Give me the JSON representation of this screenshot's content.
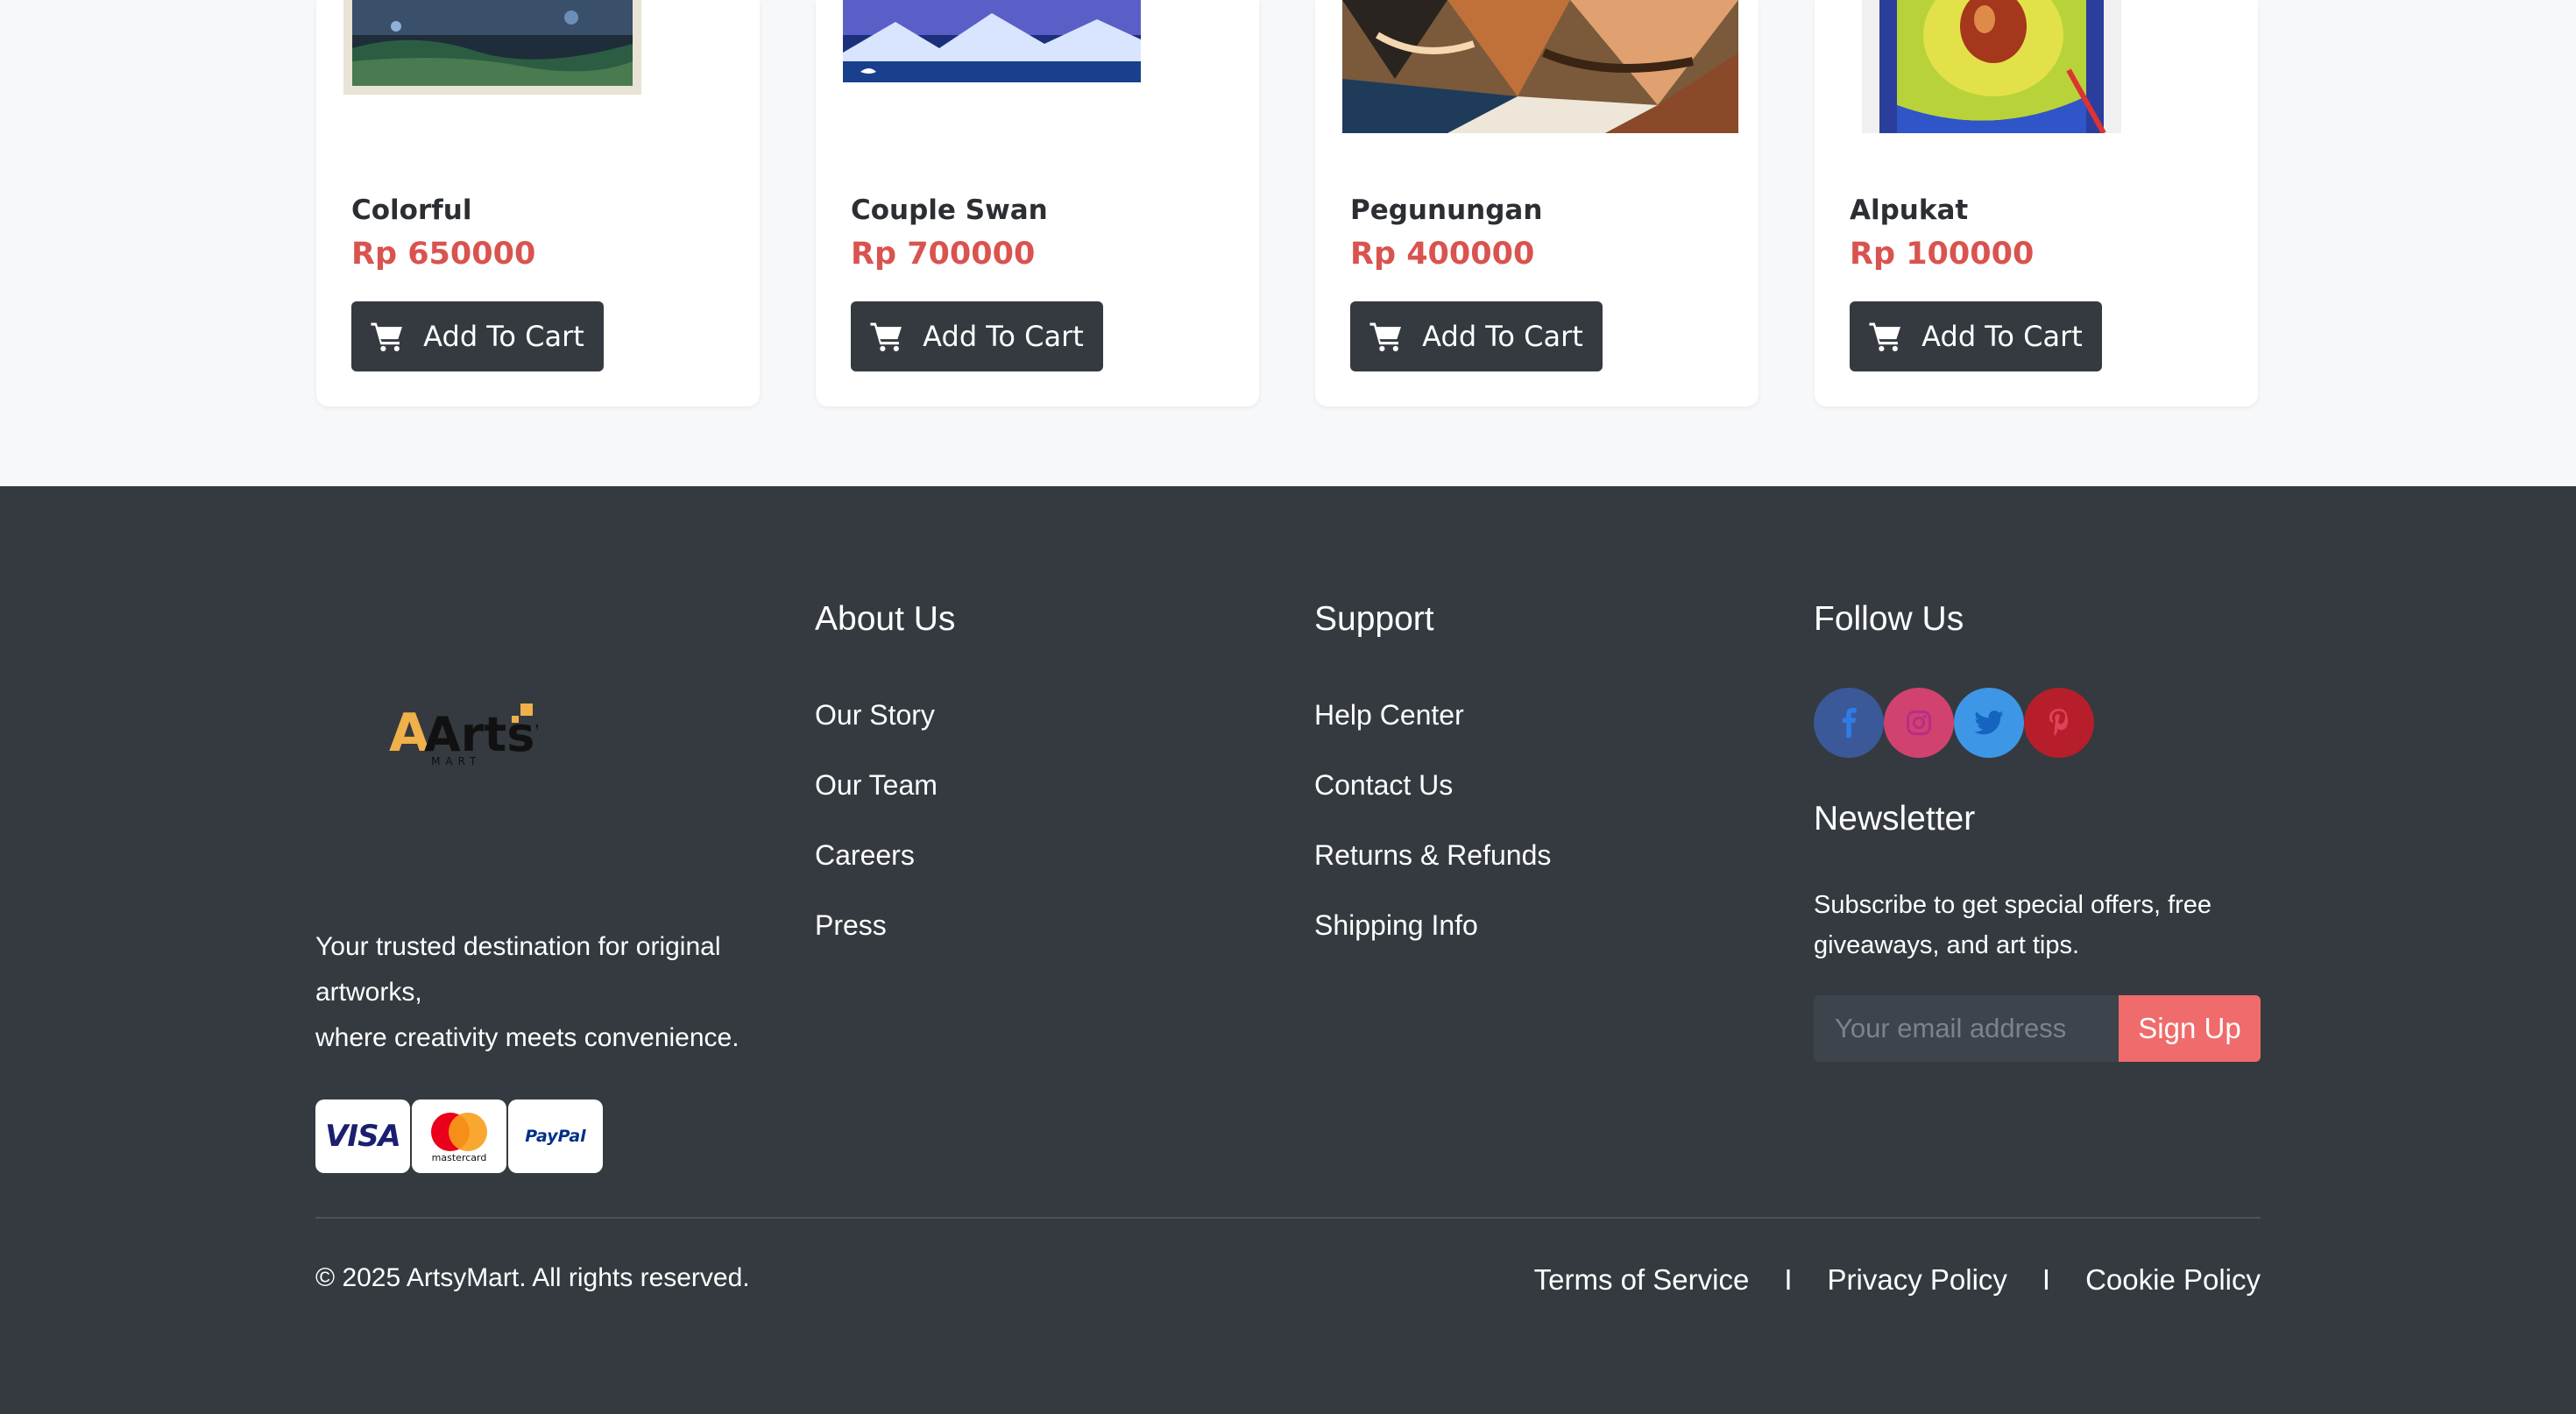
{
  "products": [
    {
      "name": "Colorful",
      "price": "Rp 650000",
      "button": "Add To Cart"
    },
    {
      "name": "Couple Swan",
      "price": "Rp 700000",
      "button": "Add To Cart"
    },
    {
      "name": "Pegunungan",
      "price": "Rp 400000",
      "button": "Add To Cart"
    },
    {
      "name": "Alpukat",
      "price": "Rp 100000",
      "button": "Add To Cart"
    }
  ],
  "footer": {
    "logo_text": "Artsy",
    "logo_sub": "MART",
    "tagline_line1": "Your trusted destination for original artworks,",
    "tagline_line2": "where creativity meets convenience.",
    "payments": [
      "VISA",
      "mastercard",
      "PayPal"
    ],
    "about": {
      "heading": "About Us",
      "links": [
        "Our Story",
        "Our Team",
        "Careers",
        "Press"
      ]
    },
    "support": {
      "heading": "Support",
      "links": [
        "Help Center",
        "Contact Us",
        "Returns & Refunds",
        "Shipping Info"
      ]
    },
    "follow": {
      "heading": "Follow Us",
      "icons": [
        "facebook-icon",
        "instagram-icon",
        "twitter-icon",
        "pinterest-icon"
      ]
    },
    "newsletter": {
      "heading": "Newsletter",
      "text": "Subscribe to get special offers, free giveaways, and art tips.",
      "placeholder": "Your email address",
      "button": "Sign Up"
    },
    "copyright": "© 2025 ArtsyMart. All rights reserved.",
    "legal": [
      "Terms of Service",
      "Privacy Policy",
      "Cookie Policy"
    ],
    "legal_separator": "I"
  },
  "colors": {
    "footer_bg": "#343a40",
    "price": "#d9534f",
    "button_dark": "#343a40",
    "signup": "#f06b6b",
    "logo_accent": "#f0b04a",
    "facebook": "#3b5998",
    "instagram": "#e1306c",
    "twitter": "#1da1f2",
    "pinterest": "#bd081c"
  }
}
